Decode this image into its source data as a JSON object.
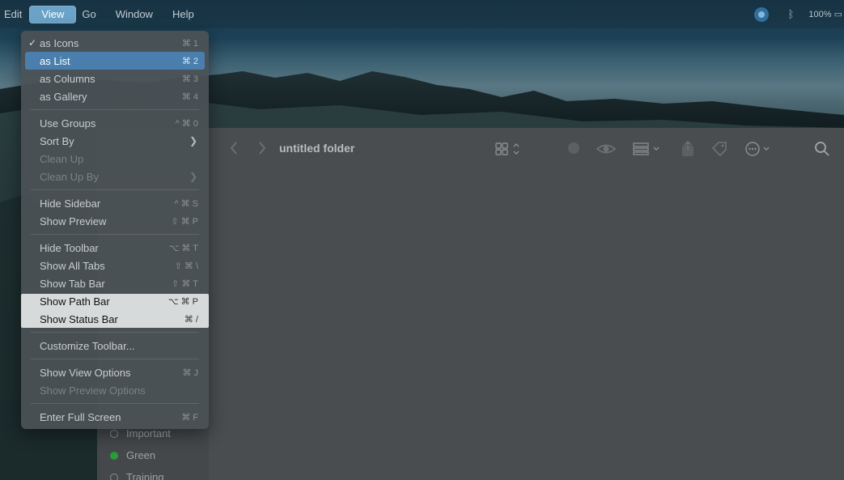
{
  "menubar": {
    "items": [
      "Edit",
      "View",
      "Go",
      "Window",
      "Help"
    ],
    "battery": "100%"
  },
  "finder": {
    "title": "untitled folder",
    "tags": [
      "Important",
      "Green",
      "Training"
    ]
  },
  "view_menu": {
    "items": [
      {
        "label": "as Icons",
        "shortcut": "⌘ 1",
        "checked": true
      },
      {
        "label": "as List",
        "shortcut": "⌘ 2",
        "selected": true
      },
      {
        "label": "as Columns",
        "shortcut": "⌘ 3"
      },
      {
        "label": "as Gallery",
        "shortcut": "⌘ 4"
      },
      {
        "label": "Use Groups",
        "shortcut": "^ ⌘ 0"
      },
      {
        "label": "Sort By",
        "submenu": true
      },
      {
        "label": "Clean Up",
        "disabled": true
      },
      {
        "label": "Clean Up By",
        "disabled": true,
        "submenu": true
      },
      {
        "label": "Hide Sidebar",
        "shortcut": "^ ⌘ S"
      },
      {
        "label": "Show Preview",
        "shortcut": "⇧ ⌘ P"
      },
      {
        "label": "Hide Toolbar",
        "shortcut": "⌥ ⌘ T"
      },
      {
        "label": "Show All Tabs",
        "shortcut": "⇧ ⌘ \\"
      },
      {
        "label": "Show Tab Bar",
        "shortcut": "⇧ ⌘ T"
      },
      {
        "label": "Show Path Bar",
        "shortcut": "⌥ ⌘ P",
        "highlighted": true
      },
      {
        "label": "Show Status Bar",
        "shortcut": "⌘ /",
        "highlighted": true
      },
      {
        "label": "Customize Toolbar..."
      },
      {
        "label": "Show View Options",
        "shortcut": "⌘ J"
      },
      {
        "label": "Show Preview Options",
        "disabled": true
      },
      {
        "label": "Enter Full Screen",
        "shortcut": "⌘ F"
      }
    ]
  },
  "colors": {
    "menu_selection": "#4a7fad",
    "menubar_active": "#6aa3c7",
    "highlight_box": "#d7dadb",
    "tag_green": "#2a9a3c"
  }
}
